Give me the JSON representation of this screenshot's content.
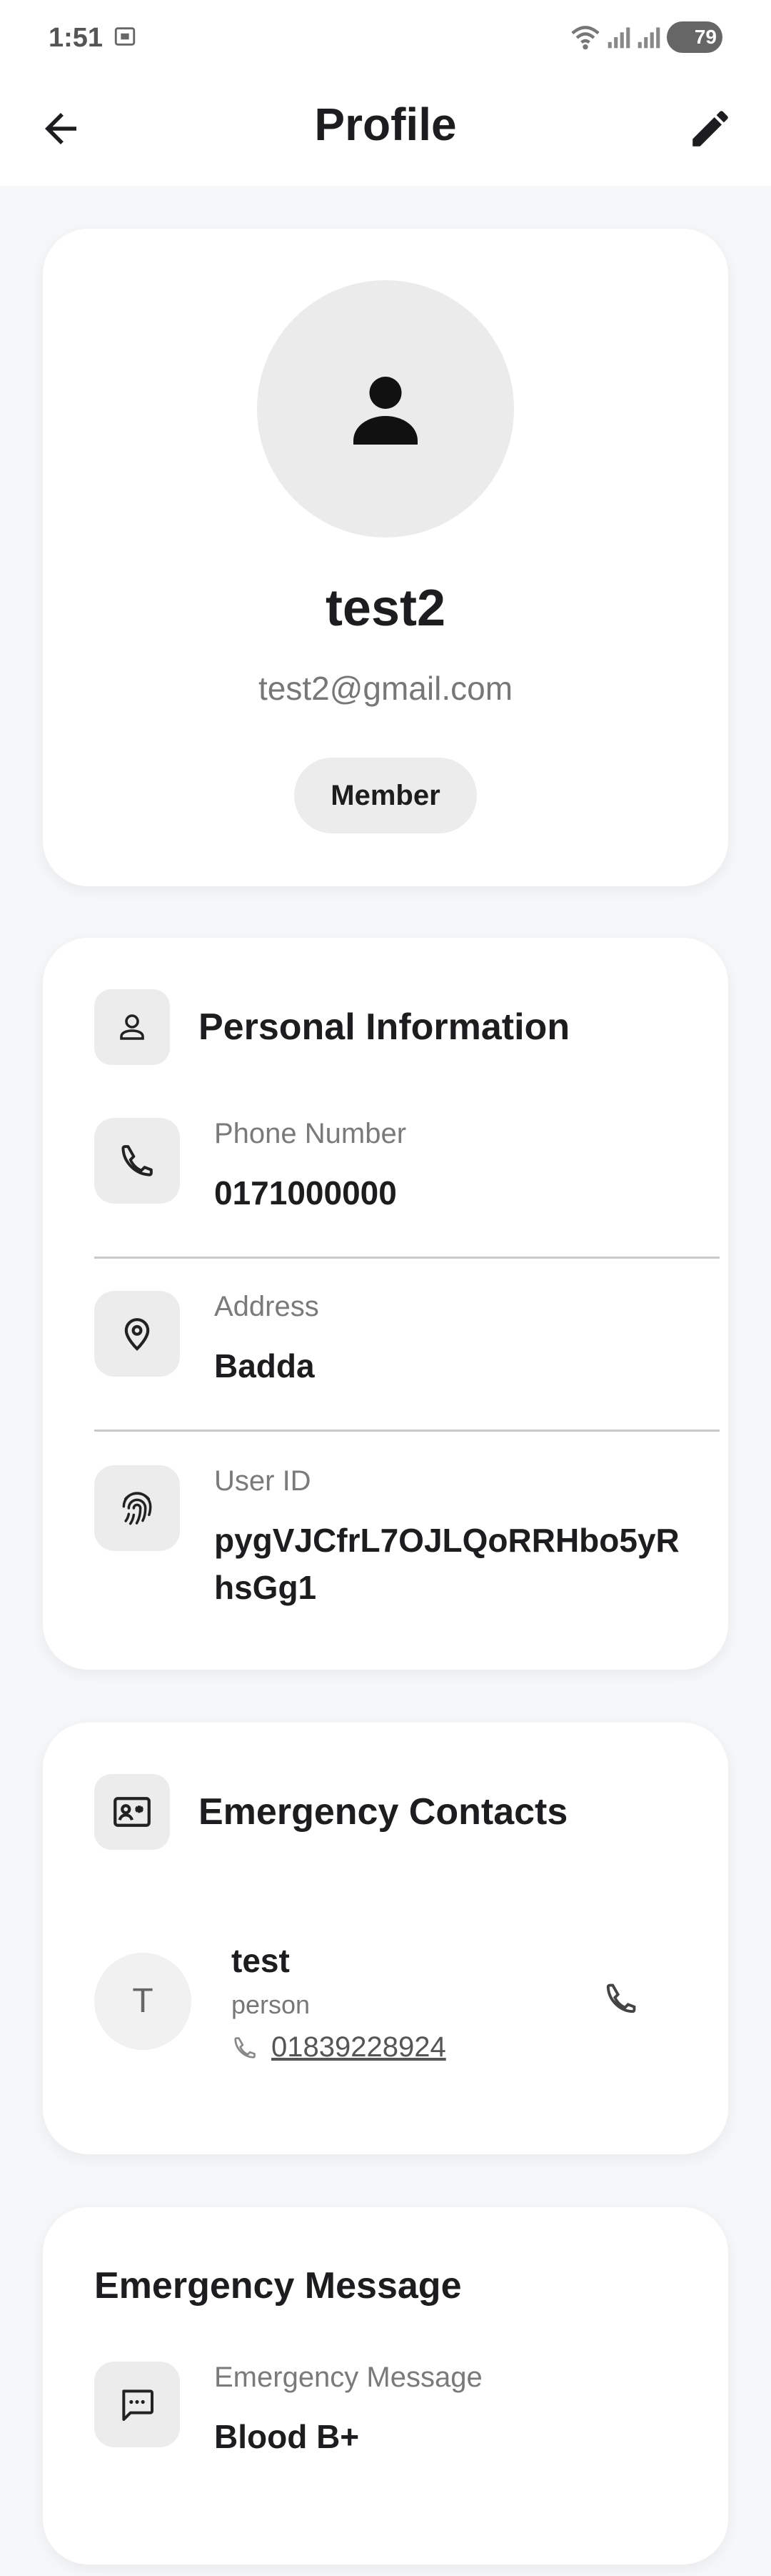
{
  "status_bar": {
    "time": "1:51",
    "battery": "79"
  },
  "header": {
    "title": "Profile"
  },
  "profile": {
    "name": "test2",
    "email": "test2@gmail.com",
    "role": "Member"
  },
  "personal_info": {
    "title": "Personal Information",
    "phone_label": "Phone Number",
    "phone_value": "0171000000",
    "address_label": "Address",
    "address_value": "Badda",
    "userid_label": "User ID",
    "userid_value": "pygVJCfrL7OJLQoRRHbo5yRhsGg1"
  },
  "emergency_contacts": {
    "title": "Emergency Contacts",
    "contacts": [
      {
        "initial": "T",
        "name": "test",
        "relation": "person",
        "phone": "01839228924"
      }
    ]
  },
  "emergency_message": {
    "title": "Emergency Message",
    "label": "Emergency Message",
    "value": "Blood B+"
  }
}
